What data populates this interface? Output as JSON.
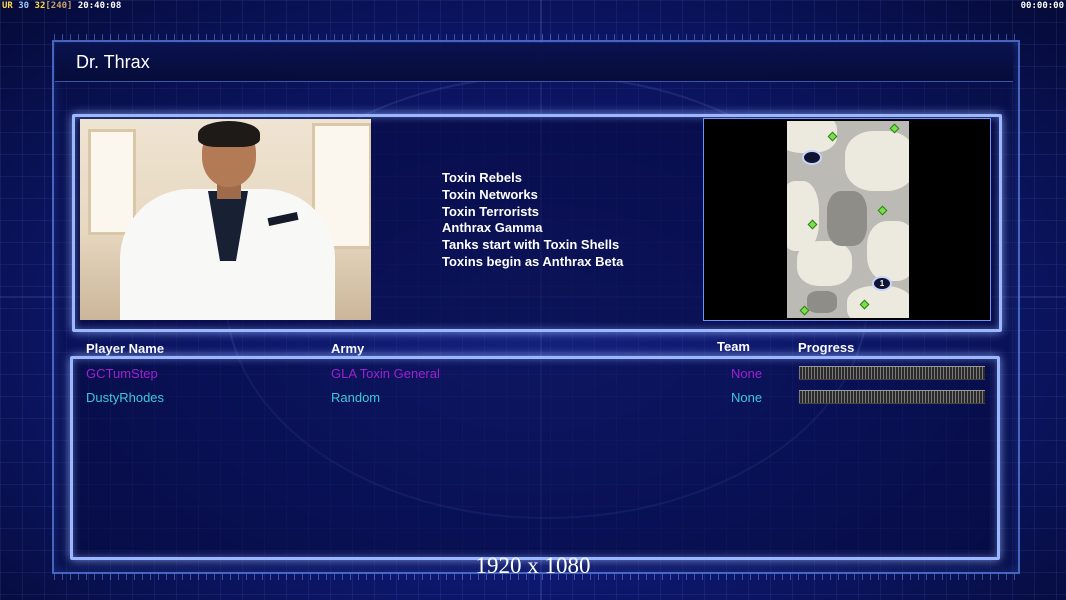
{
  "status_bar": {
    "ur": "UR",
    "fps": "30",
    "logic": "32",
    "logic_max": "[240]",
    "clock": "20:40:08",
    "timer": "00:00:00"
  },
  "general": {
    "name": "Dr. Thrax",
    "traits": [
      "Toxin Rebels",
      "Toxin Networks",
      "Toxin Terrorists",
      "Anthrax Gamma",
      "Tanks start with Toxin Shells",
      "Toxins begin as Anthrax Beta"
    ]
  },
  "map": {
    "start_marker": "1"
  },
  "players_table": {
    "headers": {
      "player_name": "Player Name",
      "army": "Army",
      "team": "Team",
      "progress": "Progress"
    },
    "rows": [
      {
        "player_name": "GCTumStep",
        "army": "GLA Toxin General",
        "team": "None",
        "color": "#a020d0"
      },
      {
        "player_name": "DustyRhodes",
        "army": "Random",
        "team": "None",
        "color": "#3ec8d8"
      }
    ]
  },
  "resolution_label": "1920 x 1080",
  "colors": {
    "panel_border": "#9bb8ff",
    "background": "#0f1a78"
  }
}
